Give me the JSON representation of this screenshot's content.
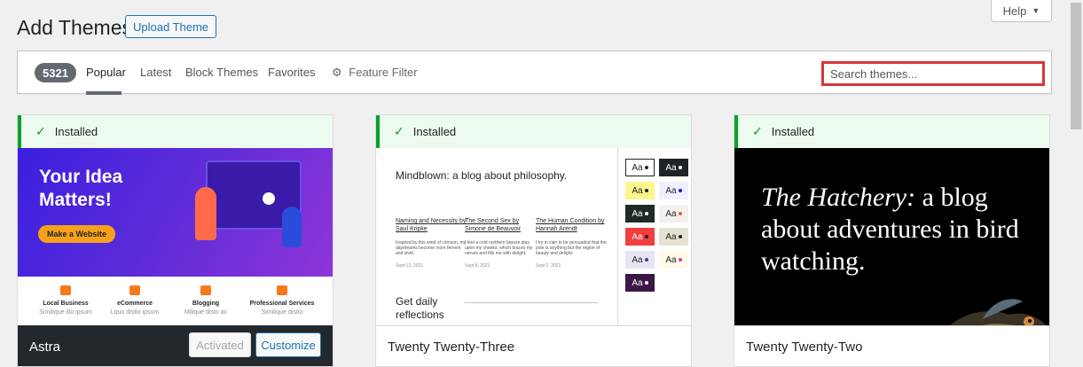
{
  "header": {
    "title": "Add Themes",
    "upload_label": "Upload Theme",
    "help_label": "Help",
    "help_icon": "caret-down-icon"
  },
  "filter": {
    "count": "5321",
    "tabs": [
      "Popular",
      "Latest",
      "Block Themes",
      "Favorites"
    ],
    "active_tab": "Popular",
    "feature_filter": "Feature Filter",
    "feature_filter_icon": "gear-icon",
    "search_placeholder": "Search themes..."
  },
  "colors": {
    "accent": "#2271b1",
    "installed_green": "#00a32a",
    "search_highlight": "#d63638"
  },
  "themes": [
    {
      "name": "Astra",
      "status": "Installed",
      "activated_label": "Activated",
      "customize_label": "Customize",
      "preview": {
        "headline": "Your Idea Matters!",
        "cta": "Make a Website",
        "features": [
          {
            "title": "Local Business",
            "text": "Similique illo ipsum"
          },
          {
            "title": "eCommerce",
            "text": "Lquo distio ipsum"
          },
          {
            "title": "Blogging",
            "text": "Milique disto ac"
          },
          {
            "title": "Professional Services",
            "text": "Similique distio"
          }
        ]
      }
    },
    {
      "name": "Twenty Twenty-Three",
      "status": "Installed",
      "preview": {
        "title": "Mindblown: a blog about philosophy.",
        "posts": [
          {
            "title": "Naming and Necessity by Saul Kripke",
            "excerpt": "Inspired by this wind of crimson, my daydreams become more fervent and vivid.",
            "date": "Sept 12, 2021"
          },
          {
            "title": "The Second Sex by Simone de Beauvoir",
            "excerpt": "I feel a cold northern breeze play upon my cheeks, which braces my nerves and fills me with delight.",
            "date": "Sept 8, 2021"
          },
          {
            "title": "The Human Condition by Hannah Arendt",
            "excerpt": "I try in vain to be persuaded that the pole is anything but the region of beauty and delight.",
            "date": "Sept 2, 2021"
          }
        ],
        "subtitle": "Get daily reflections",
        "swatch_label": "Aa"
      }
    },
    {
      "name": "Twenty Twenty-Two",
      "status": "Installed",
      "preview": {
        "title_italic": "The Hatchery:",
        "title_rest": " a blog about adventures in bird watching."
      }
    }
  ]
}
